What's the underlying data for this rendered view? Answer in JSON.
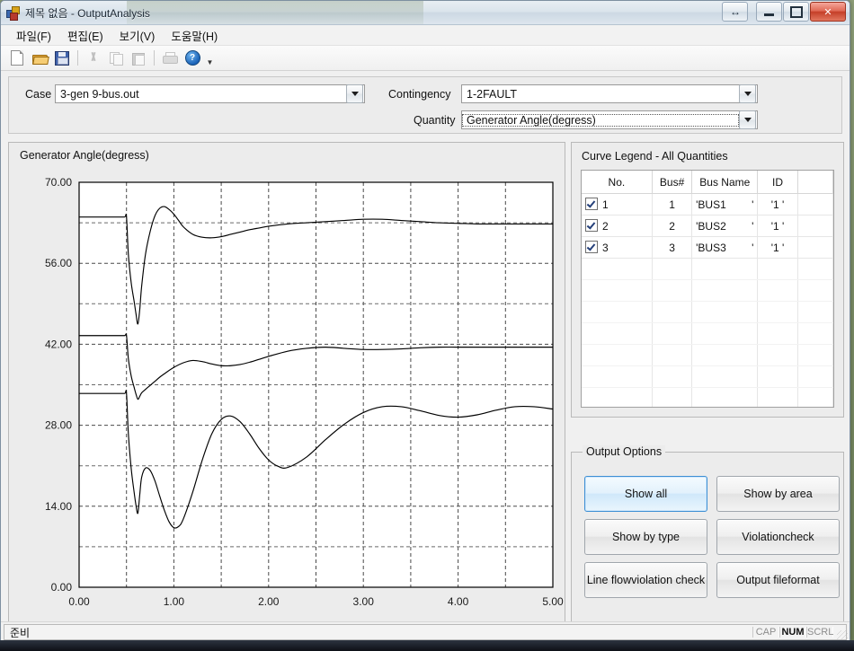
{
  "window": {
    "title": "제목 없음 - OutputAnalysis",
    "app_icon": "blocks-icon",
    "buttons": {
      "resize": "↔",
      "minimize": "minimize",
      "maximize": "maximize",
      "close": "✕"
    }
  },
  "menubar": {
    "items": [
      {
        "label": "파일(F)",
        "name": "menu-file"
      },
      {
        "label": "편집(E)",
        "name": "menu-edit"
      },
      {
        "label": "보기(V)",
        "name": "menu-view"
      },
      {
        "label": "도움말(H)",
        "name": "menu-help"
      }
    ]
  },
  "toolbar": {
    "items": [
      {
        "name": "new-icon",
        "enabled": true
      },
      {
        "name": "open-icon",
        "enabled": true
      },
      {
        "name": "save-icon",
        "enabled": true
      },
      {
        "name": "cut-icon",
        "enabled": false
      },
      {
        "name": "copy-icon",
        "enabled": false
      },
      {
        "name": "paste-icon",
        "enabled": false
      },
      {
        "name": "print-icon",
        "enabled": false
      },
      {
        "name": "help-icon",
        "enabled": true
      }
    ],
    "help_glyph": "?",
    "overflow_caret": "▼"
  },
  "selectors": {
    "case_label": "Case",
    "case_value": "3-gen 9-bus.out",
    "contingency_label": "Contingency",
    "contingency_value": "1-2FAULT",
    "quantity_label": "Quantity",
    "quantity_value": "Generator Angle(degress)"
  },
  "chart_panel": {
    "title": "Generator Angle(degress)"
  },
  "legend": {
    "title": "Curve Legend - All Quantities",
    "columns": [
      "No.",
      "Bus#",
      "Bus Name",
      "ID",
      ""
    ],
    "rows": [
      {
        "checked": true,
        "no": "1",
        "bus": "1",
        "busname": "'BUS1",
        "busname_close": "'",
        "id": "'1 '"
      },
      {
        "checked": true,
        "no": "2",
        "bus": "2",
        "busname": "'BUS2",
        "busname_close": "'",
        "id": "'1 '"
      },
      {
        "checked": true,
        "no": "3",
        "bus": "3",
        "busname": "'BUS3",
        "busname_close": "'",
        "id": "'1 '"
      }
    ]
  },
  "output_options": {
    "title": "Output Options",
    "buttons": [
      {
        "label": "Show all",
        "name": "show-all-button",
        "primary": true
      },
      {
        "label": "Show by area",
        "name": "show-by-area-button",
        "primary": false
      },
      {
        "label": "Show by type",
        "name": "show-by-type-button",
        "primary": false
      },
      {
        "label": "Violation\ncheck",
        "name": "violation-check-button",
        "primary": false
      },
      {
        "label": "Line flow\nviolation check",
        "name": "line-flow-violation-check-button",
        "primary": false
      },
      {
        "label": "Output file\nformat",
        "name": "output-file-format-button",
        "primary": false
      }
    ]
  },
  "statusbar": {
    "text": "준비",
    "indicators": [
      {
        "label": "CAP",
        "active": false
      },
      {
        "label": "NUM",
        "active": true
      },
      {
        "label": "SCRL",
        "active": false
      }
    ]
  },
  "chart_data": {
    "type": "line",
    "title": "Generator Angle(degress)",
    "xlabel": "",
    "ylabel": "",
    "xlim": [
      0.0,
      5.0
    ],
    "ylim": [
      0.0,
      70.0
    ],
    "xticks": [
      0.0,
      1.0,
      2.0,
      3.0,
      4.0,
      5.0
    ],
    "xticklabels": [
      "0.00",
      "1.00",
      "2.00",
      "3.00",
      "4.00",
      "5.00"
    ],
    "yticks": [
      0.0,
      14.0,
      28.0,
      42.0,
      56.0,
      70.0
    ],
    "yticklabels": [
      "0.00",
      "14.00",
      "28.00",
      "42.00",
      "56.00",
      "70.00"
    ],
    "minor_xticks": [
      0.5,
      1.5,
      2.5,
      3.5,
      4.5
    ],
    "minor_yticks": [
      7.0,
      21.0,
      35.0,
      49.0,
      63.0
    ],
    "grid": true,
    "grid_style": "dashed",
    "legend_position": "none",
    "line_color": "#000000",
    "series": [
      {
        "name": "'BUS1 ' ID '1 '",
        "x": [
          0.0,
          0.1,
          0.2,
          0.3,
          0.4,
          0.48,
          0.5,
          0.52,
          0.55,
          0.58,
          0.6,
          0.62,
          0.64,
          0.66,
          0.7,
          0.75,
          0.8,
          0.85,
          0.9,
          0.95,
          1.0,
          1.05,
          1.1,
          1.2,
          1.3,
          1.4,
          1.5,
          1.6,
          1.7,
          1.8,
          1.9,
          2.0,
          2.2,
          2.4,
          2.6,
          2.8,
          3.0,
          3.2,
          3.4,
          3.6,
          3.8,
          4.0,
          4.2,
          4.4,
          4.6,
          4.8,
          5.0
        ],
        "y": [
          64.0,
          64.0,
          64.0,
          64.0,
          64.0,
          64.0,
          64.0,
          57.5,
          52.6,
          49.5,
          47.3,
          45.5,
          48.0,
          52.0,
          57.5,
          61.5,
          64.2,
          65.5,
          65.8,
          65.3,
          64.5,
          63.4,
          62.3,
          61.0,
          60.5,
          60.4,
          60.6,
          61.0,
          61.4,
          61.8,
          62.1,
          62.4,
          62.8,
          63.0,
          63.2,
          63.4,
          63.6,
          63.6,
          63.4,
          63.2,
          63.0,
          62.9,
          62.8,
          62.8,
          62.8,
          62.8,
          62.8
        ]
      },
      {
        "name": "'BUS2 ' ID '1 '",
        "x": [
          0.0,
          0.1,
          0.2,
          0.3,
          0.4,
          0.48,
          0.5,
          0.52,
          0.55,
          0.58,
          0.6,
          0.62,
          0.64,
          0.66,
          0.7,
          0.75,
          0.8,
          0.85,
          0.9,
          1.0,
          1.1,
          1.2,
          1.3,
          1.4,
          1.5,
          1.6,
          1.7,
          1.8,
          1.9,
          2.0,
          2.2,
          2.4,
          2.6,
          2.8,
          3.0,
          3.2,
          3.4,
          3.6,
          3.8,
          4.0,
          4.2,
          4.4,
          4.6,
          4.8,
          5.0
        ],
        "y": [
          43.5,
          43.5,
          43.5,
          43.5,
          43.5,
          43.5,
          43.5,
          39.5,
          36.5,
          34.6,
          33.4,
          32.5,
          33.0,
          33.6,
          34.2,
          34.9,
          35.6,
          36.3,
          36.9,
          38.0,
          38.8,
          39.2,
          39.0,
          38.6,
          38.3,
          38.3,
          38.5,
          38.9,
          39.4,
          39.9,
          40.8,
          41.3,
          41.5,
          41.3,
          41.1,
          41.1,
          41.2,
          41.4,
          41.5,
          41.5,
          41.5,
          41.5,
          41.5,
          41.5,
          41.5
        ]
      },
      {
        "name": "'BUS3 ' ID '1 '",
        "x": [
          0.0,
          0.1,
          0.2,
          0.3,
          0.4,
          0.48,
          0.5,
          0.52,
          0.55,
          0.58,
          0.6,
          0.62,
          0.64,
          0.66,
          0.7,
          0.75,
          0.8,
          0.85,
          0.9,
          0.95,
          1.0,
          1.05,
          1.1,
          1.2,
          1.3,
          1.4,
          1.5,
          1.6,
          1.7,
          1.8,
          1.9,
          2.0,
          2.1,
          2.2,
          2.4,
          2.6,
          2.8,
          3.0,
          3.2,
          3.4,
          3.6,
          3.8,
          4.0,
          4.2,
          4.4,
          4.6,
          4.8,
          5.0
        ],
        "y": [
          33.5,
          33.5,
          33.5,
          33.5,
          33.5,
          33.5,
          33.5,
          26.5,
          20.5,
          16.5,
          14.2,
          12.8,
          16.0,
          19.0,
          20.6,
          20.2,
          18.4,
          15.8,
          13.3,
          11.3,
          10.3,
          10.5,
          11.8,
          16.5,
          22.0,
          26.5,
          29.0,
          29.6,
          28.6,
          26.5,
          24.0,
          22.0,
          20.9,
          20.7,
          22.5,
          25.5,
          28.2,
          30.2,
          31.2,
          31.2,
          30.5,
          29.7,
          29.4,
          29.8,
          30.6,
          31.2,
          31.2,
          30.8
        ]
      }
    ]
  }
}
